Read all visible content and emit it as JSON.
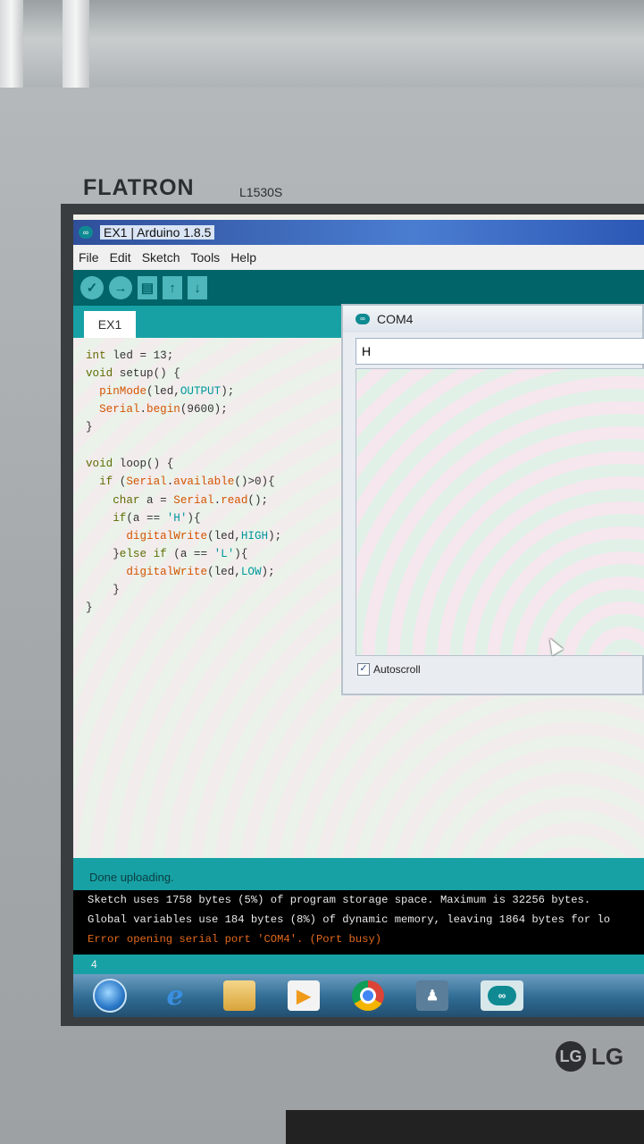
{
  "monitor": {
    "brand": "FLATRON",
    "model": "L1530S",
    "maker": "LG",
    "maker_circle": "LG"
  },
  "window": {
    "title": "EX1 | Arduino 1.8.5",
    "icon": "arduino-icon"
  },
  "menu": [
    "File",
    "Edit",
    "Sketch",
    "Tools",
    "Help"
  ],
  "toolbar": {
    "verify": "verify-icon",
    "upload": "upload-icon",
    "new": "new-icon",
    "open": "open-icon",
    "save": "save-icon",
    "verify_glyph": "✓",
    "upload_glyph": "→",
    "new_glyph": "▤",
    "open_glyph": "↑",
    "save_glyph": "↓"
  },
  "tab": {
    "label": "EX1"
  },
  "code": [
    "int led = 13;",
    "void setup() {",
    "  pinMode(led,OUTPUT);",
    "  Serial.begin(9600);",
    "}",
    "",
    "void loop() {",
    "  if (Serial.available()>0){",
    "    char a = Serial.read();",
    "    if(a == 'H'){",
    "      digitalWrite(led,HIGH);",
    "    }else if (a == 'L'){",
    "      digitalWrite(led,LOW);",
    "    }",
    "}"
  ],
  "status": {
    "text": "Done uploading."
  },
  "console": [
    {
      "text": "Sketch uses 1758 bytes (5%) of program storage space. Maximum is 32256 bytes.",
      "type": "info"
    },
    {
      "text": "Global variables use 184 bytes (8%) of dynamic memory, leaving 1864 bytes for lo",
      "type": "info"
    },
    {
      "text": "Error opening serial port 'COM4'. (Port busy)",
      "type": "error"
    }
  ],
  "line_number": "4",
  "serial_monitor": {
    "title": "COM4",
    "input_value": "H",
    "autoscroll_label": "Autoscroll",
    "autoscroll_checked": true,
    "check_glyph": "✓"
  },
  "taskbar": {
    "items": [
      "start-orb",
      "internet-explorer",
      "file-explorer",
      "media-player",
      "chrome",
      "user",
      "arduino-ide"
    ],
    "ie_glyph": "e",
    "media_glyph": "▶",
    "user_glyph": "♟",
    "arduino_glyph": "∞"
  }
}
